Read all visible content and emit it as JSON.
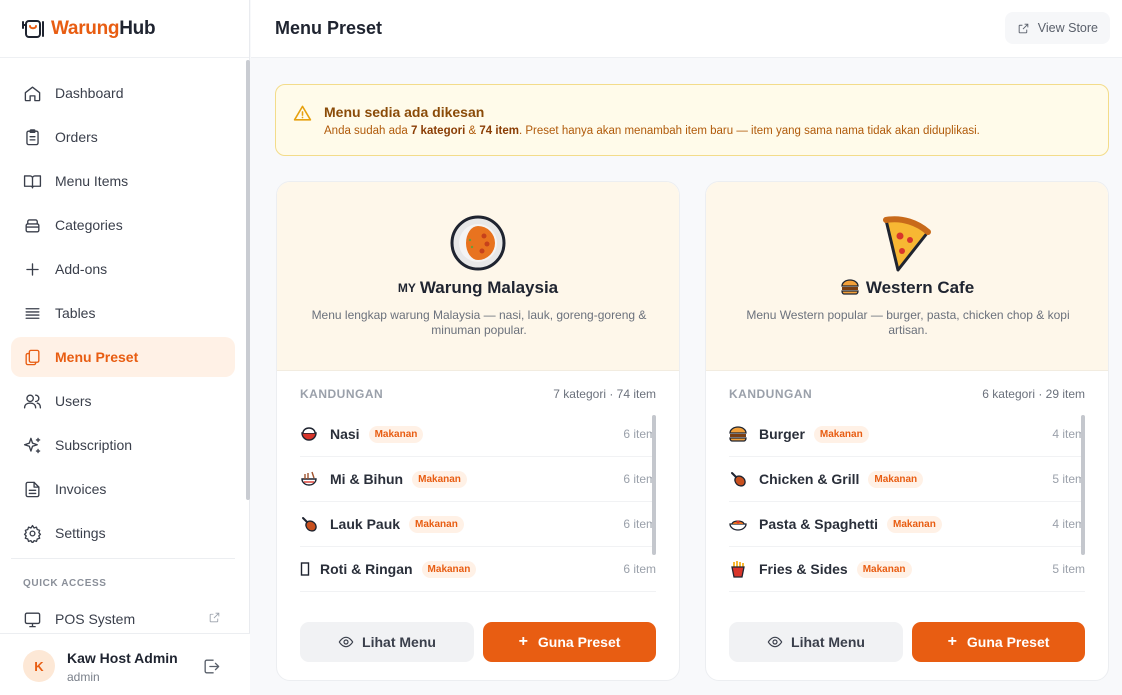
{
  "brand": {
    "part1": "Warung",
    "part2": "Hub"
  },
  "sidebar": {
    "items": [
      {
        "label": "Dashboard",
        "icon": "home-icon"
      },
      {
        "label": "Orders",
        "icon": "clipboard-icon"
      },
      {
        "label": "Menu Items",
        "icon": "book-icon"
      },
      {
        "label": "Categories",
        "icon": "layers-icon"
      },
      {
        "label": "Add-ons",
        "icon": "plus-icon"
      },
      {
        "label": "Tables",
        "icon": "list-icon"
      },
      {
        "label": "Menu Preset",
        "icon": "copy-icon",
        "active": true
      },
      {
        "label": "Users",
        "icon": "users-icon"
      },
      {
        "label": "Subscription",
        "icon": "sparkles-icon"
      },
      {
        "label": "Invoices",
        "icon": "file-icon"
      },
      {
        "label": "Settings",
        "icon": "gear-icon"
      }
    ],
    "quick_access_label": "QUICK ACCESS",
    "pos_label": "POS System"
  },
  "user": {
    "initial": "K",
    "name": "Kaw Host Admin",
    "role": "admin"
  },
  "header": {
    "title": "Menu Preset",
    "view_store": "View Store"
  },
  "alert": {
    "title": "Menu sedia ada dikesan",
    "text_pre": "Anda sudah ada ",
    "categories": "7 kategori",
    "amp": " & ",
    "items": "74 item",
    "text_post": ". Preset hanya akan menambah item baru — item yang sama nama tidak akan diduplikasi."
  },
  "presets": [
    {
      "flag": "MY",
      "title": "Warung Malaysia",
      "desc": "Menu lengkap warung Malaysia — nasi, lauk, goreng-goreng & minuman popular.",
      "contents_label": "KANDUNGAN",
      "count": "7 kategori · 74 item",
      "rows": [
        {
          "name": "Nasi",
          "tag": "Makanan",
          "count": "6 item",
          "icon": "rice-bowl-icon"
        },
        {
          "name": "Mi & Bihun",
          "tag": "Makanan",
          "count": "6 item",
          "icon": "noodles-icon"
        },
        {
          "name": "Lauk Pauk",
          "tag": "Makanan",
          "count": "6 item",
          "icon": "drumstick-icon"
        },
        {
          "name": "Roti & Ringan",
          "tag": "Makanan",
          "count": "6 item",
          "icon": "bread-icon"
        }
      ],
      "view_label": "Lihat Menu",
      "use_label": "Guna Preset"
    },
    {
      "title": "Western Cafe",
      "desc": "Menu Western popular — burger, pasta, chicken chop & kopi artisan.",
      "contents_label": "KANDUNGAN",
      "count": "6 kategori · 29 item",
      "rows": [
        {
          "name": "Burger",
          "tag": "Makanan",
          "count": "4 item",
          "icon": "burger-icon"
        },
        {
          "name": "Chicken & Grill",
          "tag": "Makanan",
          "count": "5 item",
          "icon": "drumstick-icon"
        },
        {
          "name": "Pasta & Spaghetti",
          "tag": "Makanan",
          "count": "4 item",
          "icon": "pasta-icon"
        },
        {
          "name": "Fries & Sides",
          "tag": "Makanan",
          "count": "5 item",
          "icon": "fries-icon"
        }
      ],
      "view_label": "Lihat Menu",
      "use_label": "Guna Preset"
    }
  ],
  "colors": {
    "accent": "#e85d12",
    "accent_bg": "#fff1e6",
    "alert_bg": "#fffbea"
  }
}
